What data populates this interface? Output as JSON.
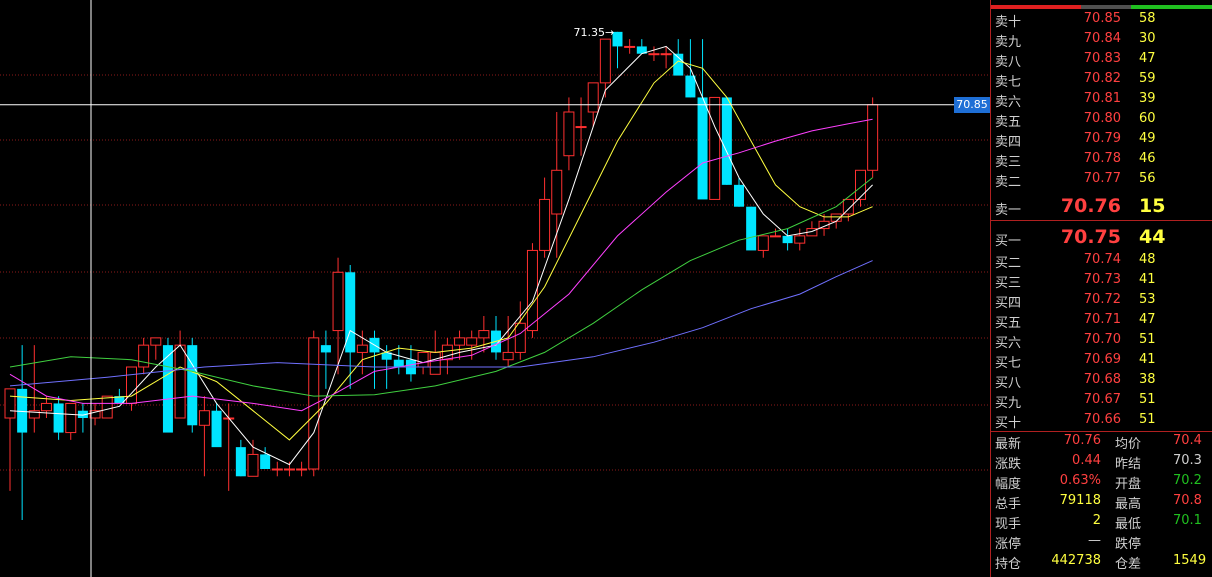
{
  "chart_data": {
    "type": "candlestick",
    "ylim": [
      68.0,
      71.5
    ],
    "crosshair_price": "70.85",
    "high_marker": "71.35",
    "candles": [
      [
        68.7,
        68.9,
        68.2,
        68.9
      ],
      [
        68.9,
        69.2,
        68.0,
        68.6
      ],
      [
        68.7,
        69.2,
        68.6,
        68.75
      ],
      [
        68.75,
        68.85,
        68.7,
        68.8
      ],
      [
        68.8,
        68.85,
        68.55,
        68.6
      ],
      [
        68.6,
        68.8,
        68.55,
        68.8
      ],
      [
        68.75,
        68.8,
        68.6,
        68.7
      ],
      [
        68.7,
        68.8,
        68.65,
        68.75
      ],
      [
        68.7,
        68.85,
        68.7,
        68.85
      ],
      [
        68.85,
        68.9,
        68.8,
        68.8
      ],
      [
        68.8,
        69.05,
        68.75,
        69.05
      ],
      [
        69.05,
        69.25,
        69.0,
        69.2
      ],
      [
        69.2,
        69.25,
        69.1,
        69.25
      ],
      [
        69.2,
        69.25,
        68.7,
        68.6
      ],
      [
        68.7,
        69.3,
        68.9,
        69.2
      ],
      [
        69.2,
        69.25,
        68.6,
        68.65
      ],
      [
        68.65,
        68.85,
        68.3,
        68.75
      ],
      [
        68.75,
        68.8,
        68.6,
        68.5
      ],
      [
        68.7,
        68.8,
        68.2,
        68.7
      ],
      [
        68.5,
        68.55,
        68.3,
        68.3
      ],
      [
        68.3,
        68.55,
        68.3,
        68.45
      ],
      [
        68.45,
        68.5,
        68.35,
        68.35
      ],
      [
        68.35,
        68.4,
        68.3,
        68.35
      ],
      [
        68.35,
        68.4,
        68.3,
        68.35
      ],
      [
        68.35,
        68.4,
        68.3,
        68.35
      ],
      [
        68.35,
        69.3,
        68.3,
        69.25
      ],
      [
        69.2,
        69.3,
        68.9,
        69.15
      ],
      [
        69.3,
        69.8,
        69.0,
        69.7
      ],
      [
        69.7,
        69.75,
        68.9,
        69.15
      ],
      [
        69.15,
        69.3,
        69.0,
        69.2
      ],
      [
        69.25,
        69.3,
        68.9,
        69.15
      ],
      [
        69.15,
        69.2,
        68.9,
        69.1
      ],
      [
        69.1,
        69.2,
        69.0,
        69.05
      ],
      [
        69.1,
        69.2,
        68.95,
        69.0
      ],
      [
        69.05,
        69.15,
        69.0,
        69.15
      ],
      [
        69.0,
        69.3,
        69.0,
        69.15
      ],
      [
        69.1,
        69.25,
        69.0,
        69.2
      ],
      [
        69.2,
        69.3,
        69.1,
        69.25
      ],
      [
        69.2,
        69.3,
        69.1,
        69.25
      ],
      [
        69.25,
        69.4,
        69.15,
        69.3
      ],
      [
        69.3,
        69.4,
        69.1,
        69.15
      ],
      [
        69.1,
        69.4,
        69.05,
        69.15
      ],
      [
        69.15,
        69.5,
        69.1,
        69.35
      ],
      [
        69.3,
        69.9,
        69.25,
        69.85
      ],
      [
        69.85,
        70.35,
        69.8,
        70.2
      ],
      [
        70.1,
        70.8,
        69.8,
        70.4
      ],
      [
        70.5,
        70.9,
        70.4,
        70.8
      ],
      [
        70.7,
        70.9,
        70.5,
        70.7
      ],
      [
        70.8,
        71.0,
        70.7,
        71.0
      ],
      [
        71.0,
        71.1,
        70.9,
        71.3
      ],
      [
        71.35,
        71.35,
        71.1,
        71.25
      ],
      [
        71.25,
        71.3,
        71.2,
        71.25
      ],
      [
        71.25,
        71.3,
        71.2,
        71.2
      ],
      [
        71.2,
        71.25,
        71.15,
        71.2
      ],
      [
        71.2,
        71.25,
        71.1,
        71.2
      ],
      [
        71.2,
        71.3,
        71.1,
        71.05
      ],
      [
        71.05,
        71.3,
        70.9,
        70.9
      ],
      [
        70.9,
        71.3,
        70.6,
        70.2
      ],
      [
        70.2,
        70.9,
        70.2,
        70.9
      ],
      [
        70.9,
        70.9,
        70.3,
        70.3
      ],
      [
        70.3,
        70.35,
        70.15,
        70.15
      ],
      [
        70.15,
        70.15,
        70.0,
        69.85
      ],
      [
        69.85,
        69.95,
        69.8,
        69.95
      ],
      [
        69.95,
        70.0,
        69.95,
        69.95
      ],
      [
        69.95,
        70.0,
        69.85,
        69.9
      ],
      [
        69.9,
        70.0,
        69.85,
        69.95
      ],
      [
        69.95,
        70.05,
        69.95,
        70.0
      ],
      [
        70.0,
        70.1,
        69.95,
        70.05
      ],
      [
        70.05,
        70.1,
        70.0,
        70.1
      ],
      [
        70.1,
        70.2,
        70.05,
        70.2
      ],
      [
        70.2,
        70.4,
        70.15,
        70.4
      ],
      [
        70.4,
        70.9,
        70.35,
        70.85
      ]
    ],
    "ma": [
      {
        "color": "#ffffff",
        "values": [
          [
            0,
            68.75
          ],
          [
            6,
            68.72
          ],
          [
            9,
            68.78
          ],
          [
            12,
            69.05
          ],
          [
            14,
            69.2
          ],
          [
            17,
            68.8
          ],
          [
            20,
            68.5
          ],
          [
            23,
            68.38
          ],
          [
            25,
            68.6
          ],
          [
            28,
            69.3
          ],
          [
            31,
            69.15
          ],
          [
            34,
            69.08
          ],
          [
            37,
            69.15
          ],
          [
            40,
            69.2
          ],
          [
            43,
            69.5
          ],
          [
            46,
            70.2
          ],
          [
            49,
            70.95
          ],
          [
            52,
            71.2
          ],
          [
            54,
            71.25
          ],
          [
            56,
            71.1
          ],
          [
            58,
            70.7
          ],
          [
            60,
            70.35
          ],
          [
            62,
            70.1
          ],
          [
            64,
            69.95
          ],
          [
            66,
            69.98
          ],
          [
            68,
            70.05
          ],
          [
            71,
            70.3
          ]
        ]
      },
      {
        "color": "#ffff40",
        "values": [
          [
            0,
            68.85
          ],
          [
            5,
            68.82
          ],
          [
            10,
            68.85
          ],
          [
            14,
            69.05
          ],
          [
            17,
            68.95
          ],
          [
            20,
            68.75
          ],
          [
            23,
            68.55
          ],
          [
            26,
            68.8
          ],
          [
            29,
            69.1
          ],
          [
            32,
            69.18
          ],
          [
            35,
            69.15
          ],
          [
            38,
            69.18
          ],
          [
            41,
            69.25
          ],
          [
            44,
            69.6
          ],
          [
            47,
            70.1
          ],
          [
            50,
            70.6
          ],
          [
            53,
            71.0
          ],
          [
            55,
            71.15
          ],
          [
            57,
            71.1
          ],
          [
            59,
            70.9
          ],
          [
            61,
            70.6
          ],
          [
            63,
            70.3
          ],
          [
            65,
            70.15
          ],
          [
            67,
            70.08
          ],
          [
            69,
            70.08
          ],
          [
            71,
            70.15
          ]
        ]
      },
      {
        "color": "#ff40ff",
        "values": [
          [
            0,
            69.0
          ],
          [
            3,
            68.85
          ],
          [
            6,
            68.8
          ],
          [
            10,
            68.8
          ],
          [
            15,
            68.85
          ],
          [
            20,
            68.8
          ],
          [
            24,
            68.75
          ],
          [
            27,
            68.88
          ],
          [
            30,
            69.02
          ],
          [
            34,
            69.08
          ],
          [
            38,
            69.13
          ],
          [
            42,
            69.28
          ],
          [
            46,
            69.55
          ],
          [
            50,
            69.95
          ],
          [
            54,
            70.25
          ],
          [
            57,
            70.45
          ],
          [
            60,
            70.52
          ],
          [
            63,
            70.6
          ],
          [
            66,
            70.67
          ],
          [
            69,
            70.72
          ],
          [
            71,
            70.75
          ]
        ]
      },
      {
        "color": "#40d040",
        "values": [
          [
            0,
            69.05
          ],
          [
            5,
            69.12
          ],
          [
            10,
            69.1
          ],
          [
            15,
            69.02
          ],
          [
            20,
            68.92
          ],
          [
            25,
            68.85
          ],
          [
            30,
            68.86
          ],
          [
            35,
            68.92
          ],
          [
            40,
            69.02
          ],
          [
            44,
            69.15
          ],
          [
            48,
            69.35
          ],
          [
            52,
            69.58
          ],
          [
            56,
            69.78
          ],
          [
            60,
            69.92
          ],
          [
            64,
            70.0
          ],
          [
            68,
            70.15
          ],
          [
            71,
            70.35
          ]
        ]
      },
      {
        "color": "#7070ff",
        "values": [
          [
            0,
            68.92
          ],
          [
            8,
            68.98
          ],
          [
            16,
            69.05
          ],
          [
            22,
            69.08
          ],
          [
            30,
            69.05
          ],
          [
            36,
            69.05
          ],
          [
            42,
            69.05
          ],
          [
            48,
            69.12
          ],
          [
            53,
            69.22
          ],
          [
            57,
            69.32
          ],
          [
            61,
            69.45
          ],
          [
            65,
            69.55
          ],
          [
            68,
            69.67
          ],
          [
            71,
            69.78
          ]
        ]
      }
    ]
  },
  "order_book": {
    "asks": [
      {
        "label": "卖十",
        "price": "70.85",
        "vol": "58"
      },
      {
        "label": "卖九",
        "price": "70.84",
        "vol": "30"
      },
      {
        "label": "卖八",
        "price": "70.83",
        "vol": "47"
      },
      {
        "label": "卖七",
        "price": "70.82",
        "vol": "59"
      },
      {
        "label": "卖六",
        "price": "70.81",
        "vol": "39"
      },
      {
        "label": "卖五",
        "price": "70.80",
        "vol": "60"
      },
      {
        "label": "卖四",
        "price": "70.79",
        "vol": "49"
      },
      {
        "label": "卖三",
        "price": "70.78",
        "vol": "46"
      },
      {
        "label": "卖二",
        "price": "70.77",
        "vol": "56"
      },
      {
        "label": "卖一",
        "price": "70.76",
        "vol": "15"
      }
    ],
    "bids": [
      {
        "label": "买一",
        "price": "70.75",
        "vol": "44"
      },
      {
        "label": "买二",
        "price": "70.74",
        "vol": "48"
      },
      {
        "label": "买三",
        "price": "70.73",
        "vol": "41"
      },
      {
        "label": "买四",
        "price": "70.72",
        "vol": "53"
      },
      {
        "label": "买五",
        "price": "70.71",
        "vol": "47"
      },
      {
        "label": "买六",
        "price": "70.70",
        "vol": "51"
      },
      {
        "label": "买七",
        "price": "70.69",
        "vol": "41"
      },
      {
        "label": "买八",
        "price": "70.68",
        "vol": "38"
      },
      {
        "label": "买九",
        "price": "70.67",
        "vol": "51"
      },
      {
        "label": "买十",
        "price": "70.66",
        "vol": "51"
      }
    ]
  },
  "stats": [
    {
      "l1": "最新",
      "v1": "70.76",
      "c1": "#ff4040",
      "l2": "均价",
      "v2": "70.4",
      "c2": "#ff4040"
    },
    {
      "l1": "涨跌",
      "v1": "0.44",
      "c1": "#ff4040",
      "l2": "昨结",
      "v2": "70.3",
      "c2": "#d0d0d0"
    },
    {
      "l1": "幅度",
      "v1": "0.63%",
      "c1": "#ff4040",
      "l2": "开盘",
      "v2": "70.2",
      "c2": "#20c020"
    },
    {
      "l1": "总手",
      "v1": "79118",
      "c1": "#ffff40",
      "l2": "最高",
      "v2": "70.8",
      "c2": "#ff4040"
    },
    {
      "l1": "现手",
      "v1": "2",
      "c1": "#ffff40",
      "l2": "最低",
      "v2": "70.1",
      "c2": "#20c020"
    },
    {
      "l1": "涨停",
      "v1": "—",
      "c1": "#d0d0d0",
      "l2": "跌停",
      "v2": "",
      "c2": "#d0d0d0"
    },
    {
      "l1": "持仓",
      "v1": "442738",
      "c1": "#ffff40",
      "l2": "仓差",
      "v2": "1549",
      "c2": "#ffff40"
    }
  ],
  "colors": {
    "up": "#ff3030",
    "down": "#00e5ff",
    "grid": "#8b1a1a",
    "crosshair": "#ffffff"
  }
}
